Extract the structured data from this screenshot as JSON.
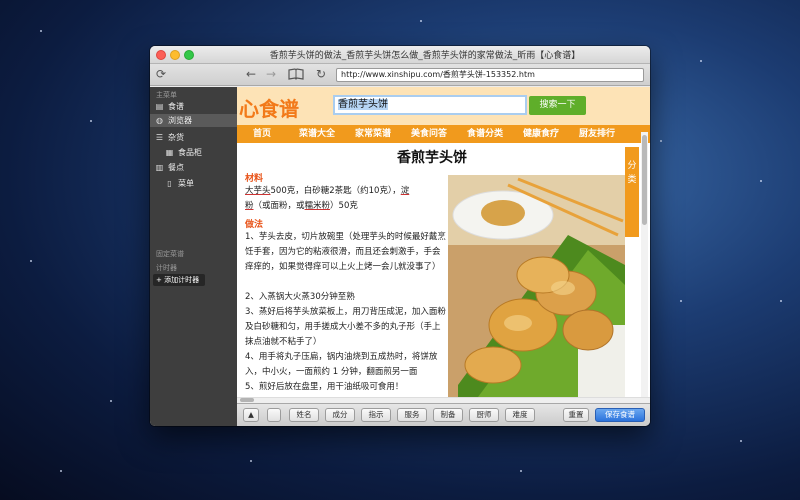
{
  "window": {
    "title": "香煎芋头饼的做法_香煎芋头饼怎么做_香煎芋头饼的家常做法_昕雨【心食谱】"
  },
  "toolbar": {
    "refresh_icon": "refresh-icon",
    "url": "http://www.xinshipu.com/香煎芋头饼-153352.htm"
  },
  "sidebar": {
    "main_header": "主菜单",
    "items": [
      {
        "label": "食谱",
        "icon": "recipes-icon"
      },
      {
        "label": "浏览器",
        "icon": "browser-globe-icon"
      },
      {
        "label": "杂货",
        "icon": "groceries-icon"
      },
      {
        "label": "食品柜",
        "icon": "pantry-icon"
      },
      {
        "label": "餐点",
        "icon": "calendar-icon"
      },
      {
        "label": "菜单",
        "icon": "menu-doc-icon"
      }
    ],
    "fixed_header": "固定菜谱",
    "timer_header": "计时器",
    "add_timer": "+ 添加计时器"
  },
  "site": {
    "logo": "心食谱",
    "search_value": "香煎芋头饼",
    "search_button": "搜索一下",
    "nav": [
      "首页",
      "菜谱大全",
      "家常菜谱",
      "美食问答",
      "食谱分类",
      "健康食疗",
      "厨友排行"
    ],
    "side_tab": "分类"
  },
  "recipe": {
    "title": "香煎芋头饼",
    "ingredients_head": "材料",
    "ingredients_line1_a": "大芋头",
    "ingredients_line1_b": "500克，白砂糖2茶匙（约10克），",
    "ingredients_line1_c": "淀",
    "ingredients_line2_a": "粉",
    "ingredients_line2_b": "（或面粉，或",
    "ingredients_line2_c": "糯米粉",
    "ingredients_line2_d": "）50克",
    "method_head": "做法",
    "steps": [
      "1、芋头去皮，切片放碗里（处理芋头的时候最好戴烹饪手套，因为它的粘液很滑，而且还会刺激手，手会痒痒的，如果觉得痒可以上火上烤一会儿就没事了）",
      "2、入蒸锅大火蒸30分钟至熟",
      "3、蒸好后将芋头放菜板上，用刀背压成泥，加入面粉及白砂糖和匀，用手搓成大小差不多的丸子形（手上抹点油就不粘手了）",
      "4、用手将丸子压扁，锅内油烧到五成热时，将饼放入，中小火，一面煎约 1 分钟，翻面煎另一面",
      "5、煎好后放在盘里，用干油纸吸可食用！"
    ]
  },
  "bottombar": {
    "buttons": [
      "姓名",
      "成分",
      "指示",
      "服务",
      "制备",
      "厨师",
      "难度"
    ],
    "reset": "重置",
    "save": "保存食谱"
  }
}
